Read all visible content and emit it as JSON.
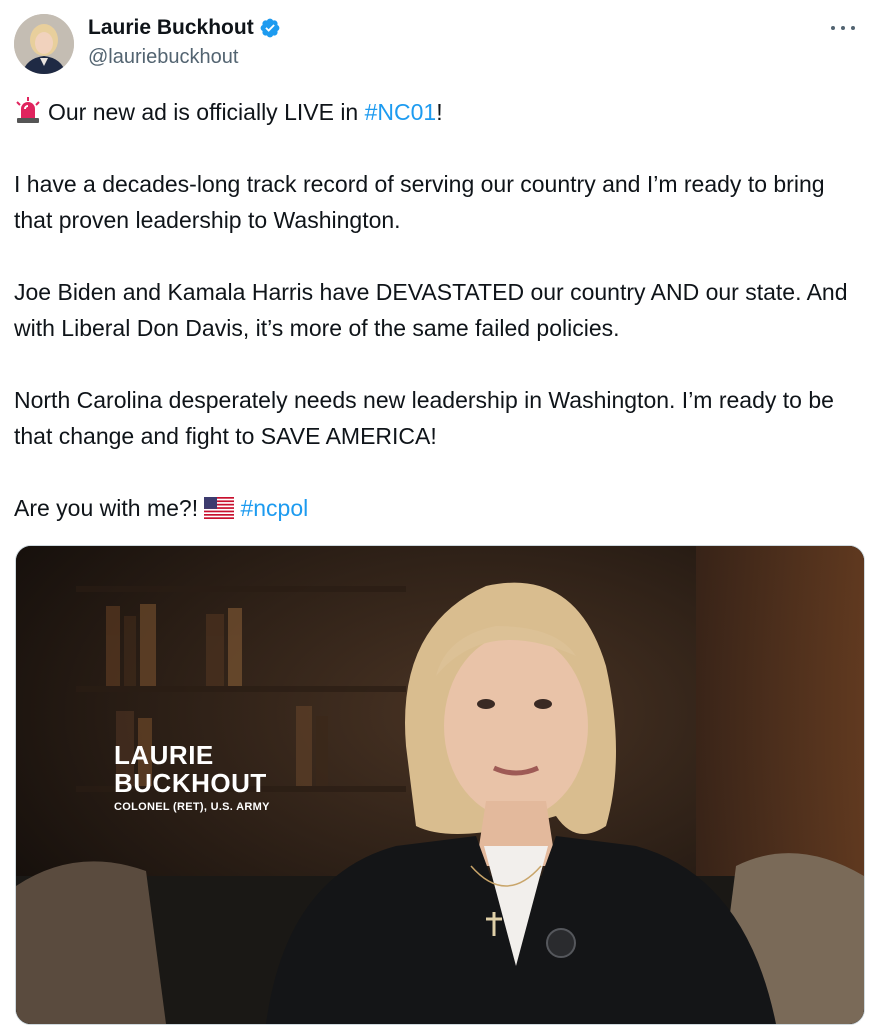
{
  "author": {
    "display_name": "Laurie Buckhout",
    "handle": "@lauriebuckhout",
    "verified": true,
    "verified_color": "#1d9bf0"
  },
  "tweet": {
    "line1_prefix": "Our new ad is officially LIVE in ",
    "line1_hashtag": "#NC01",
    "line1_suffix": "!",
    "para2": "I have a decades-long track record of serving our country and I’m ready to bring that proven leadership to Washington.",
    "para3": "Joe Biden and Kamala Harris have DEVASTATED our country AND our state. And with Liberal Don Davis, it’s more of the same failed policies.",
    "para4": "North Carolina desperately needs new leadership in Washington. I’m ready to be that change and fight to SAVE AMERICA!",
    "para5_prefix": "Are you with me?! ",
    "para5_hashtag": "#ncpol",
    "hashtag_color": "#1d9bf0"
  },
  "media": {
    "type": "video",
    "lower_third": {
      "first_name": "LAURIE",
      "last_name": "BUCKHOUT",
      "title": "COLONEL (RET), U.S. ARMY"
    }
  },
  "icons": {
    "siren": "rotating-light-icon",
    "flag": "us-flag-icon",
    "more": "more-options-icon",
    "verified": "verified-badge-icon"
  }
}
